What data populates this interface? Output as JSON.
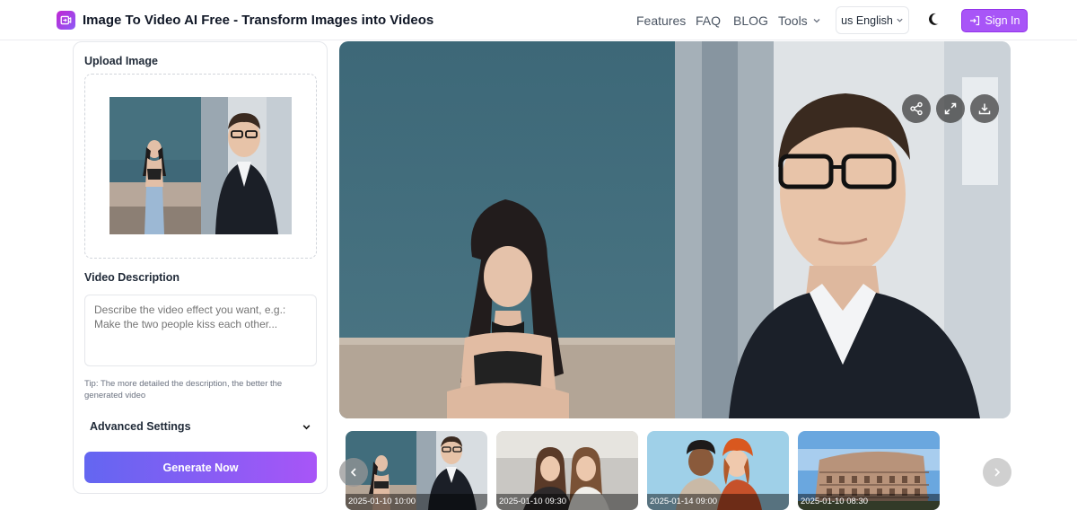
{
  "header": {
    "brand": "Image To Video AI Free - Transform Images into Videos",
    "nav": [
      "Features",
      "FAQ",
      "BLOG"
    ],
    "tools_label": "Tools",
    "language": "us English",
    "sign_in": "Sign In"
  },
  "left_panel": {
    "upload_label": "Upload Image",
    "description_label": "Video Description",
    "description_placeholder": "Describe the video effect you want, e.g.: Make the two people kiss each other...",
    "tip": "Tip: The more detailed the description, the better the generated video",
    "advanced_settings": "Advanced Settings",
    "generate_button": "Generate Now"
  },
  "history": [
    {
      "timestamp": "2025-01-10 10:00"
    },
    {
      "timestamp": "2025-01-10 09:30"
    },
    {
      "timestamp": "2025-01-14 09:00"
    },
    {
      "timestamp": "2025-01-10 08:30"
    }
  ],
  "colors": {
    "accent": "#a855f7",
    "gradient_start": "#6366f1",
    "gradient_end": "#a855f7"
  },
  "icons": [
    "video-logo-icon",
    "chevron-down-icon",
    "moon-icon",
    "sign-in-icon",
    "share-icon",
    "expand-icon",
    "download-icon",
    "chevron-left-icon",
    "chevron-right-icon"
  ]
}
